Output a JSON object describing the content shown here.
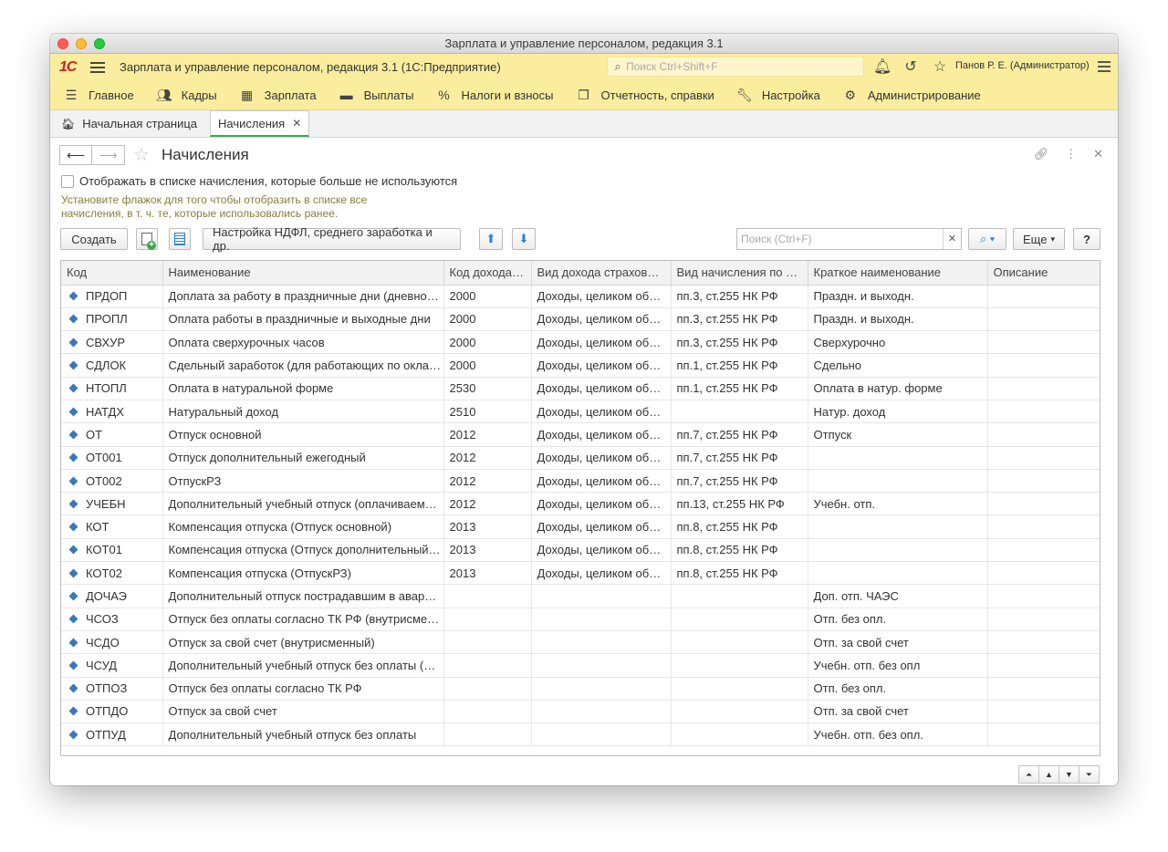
{
  "window": {
    "title": "Зарплата и управление персоналом, редакция 3.1"
  },
  "appbar": {
    "logo": "1С",
    "title": "Зарплата и управление персоналом, редакция 3.1  (1С:Предприятие)",
    "search_placeholder": "Поиск Ctrl+Shift+F",
    "user": "Панов Р. Е. (Администратор)"
  },
  "sections": [
    {
      "label": "Главное"
    },
    {
      "label": "Кадры"
    },
    {
      "label": "Зарплата"
    },
    {
      "label": "Выплаты"
    },
    {
      "label": "Налоги и взносы"
    },
    {
      "label": "Отчетность, справки"
    },
    {
      "label": "Настройка"
    },
    {
      "label": "Администрирование"
    }
  ],
  "tabs": {
    "home": "Начальная страница",
    "current": "Начисления"
  },
  "form": {
    "title": "Начисления",
    "checkbox_label": "Отображать в списке начисления, которые больше не используются",
    "hint_line1": "Установите флажок для того чтобы отобразить в списке все",
    "hint_line2": "начисления, в т. ч. те, которые использовались ранее."
  },
  "toolbar": {
    "create": "Создать",
    "settings": "Настройка НДФЛ, среднего заработка и др.",
    "filter_placeholder": "Поиск (Ctrl+F)",
    "more": "Еще",
    "help": "?"
  },
  "columns": [
    "Код",
    "Наименование",
    "Код дохода…",
    "Вид дохода страхов…",
    "Вид начисления по …",
    "Краткое наименование",
    "Описание"
  ],
  "rows": [
    [
      "ПРДОП",
      "Доплата за работу в праздничные дни (дневно…",
      "2000",
      "Доходы, целиком об…",
      "пп.3, ст.255 НК РФ",
      "Праздн. и выходн.",
      ""
    ],
    [
      "ПРОПЛ",
      "Оплата работы в праздничные и выходные дни",
      "2000",
      "Доходы, целиком об…",
      "пп.3, ст.255 НК РФ",
      "Праздн. и выходн.",
      ""
    ],
    [
      "СВХУР",
      "Оплата сверхурочных часов",
      "2000",
      "Доходы, целиком об…",
      "пп.3, ст.255 НК РФ",
      "Сверхурочно",
      ""
    ],
    [
      "СДЛОК",
      "Сдельный заработок (для работающих по окла…",
      "2000",
      "Доходы, целиком об…",
      "пп.1, ст.255 НК РФ",
      "Сдельно",
      ""
    ],
    [
      "НТОПЛ",
      "Оплата в натуральной форме",
      "2530",
      "Доходы, целиком об…",
      "пп.1, ст.255 НК РФ",
      "Оплата в натур. форме",
      ""
    ],
    [
      "НАТДХ",
      "Натуральный доход",
      "2510",
      "Доходы, целиком об…",
      "",
      "Натур. доход",
      ""
    ],
    [
      "ОТ",
      "Отпуск основной",
      "2012",
      "Доходы, целиком об…",
      "пп.7, ст.255 НК РФ",
      "Отпуск",
      ""
    ],
    [
      "ОТ001",
      "Отпуск дополнительный ежегодный",
      "2012",
      "Доходы, целиком об…",
      "пп.7, ст.255 НК РФ",
      "",
      ""
    ],
    [
      "ОТ002",
      "ОтпускРЗ",
      "2012",
      "Доходы, целиком об…",
      "пп.7, ст.255 НК РФ",
      "",
      ""
    ],
    [
      "УЧЕБН",
      "Дополнительный учебный отпуск (оплачиваем…",
      "2012",
      "Доходы, целиком об…",
      "пп.13, ст.255 НК РФ",
      "Учебн. отп.",
      ""
    ],
    [
      "КОТ",
      "Компенсация отпуска (Отпуск основной)",
      "2013",
      "Доходы, целиком об…",
      "пп.8, ст.255 НК РФ",
      "",
      ""
    ],
    [
      "КОТ01",
      "Компенсация отпуска (Отпуск дополнительный…",
      "2013",
      "Доходы, целиком об…",
      "пп.8, ст.255 НК РФ",
      "",
      ""
    ],
    [
      "КОТ02",
      "Компенсация отпуска (ОтпускРЗ)",
      "2013",
      "Доходы, целиком об…",
      "пп.8, ст.255 НК РФ",
      "",
      ""
    ],
    [
      "ДОЧАЭ",
      "Дополнительный отпуск пострадавшим в авар…",
      "",
      "",
      "",
      "Доп. отп. ЧАЭС",
      ""
    ],
    [
      "ЧСОЗ",
      "Отпуск без оплаты согласно ТК РФ (внутрисме…",
      "",
      "",
      "",
      "Отп. без опл.",
      ""
    ],
    [
      "ЧСДО",
      "Отпуск за свой счет (внутрисменный)",
      "",
      "",
      "",
      "Отп. за свой счет",
      ""
    ],
    [
      "ЧСУД",
      "Дополнительный учебный отпуск без оплаты (…",
      "",
      "",
      "",
      "Учебн. отп. без опл",
      ""
    ],
    [
      "ОТПОЗ",
      "Отпуск без оплаты согласно ТК РФ",
      "",
      "",
      "",
      "Отп. без опл.",
      ""
    ],
    [
      "ОТПДО",
      "Отпуск за свой счет",
      "",
      "",
      "",
      "Отп. за свой счет",
      ""
    ],
    [
      "ОТПУД",
      "Дополнительный учебный отпуск без оплаты",
      "",
      "",
      "",
      "Учебн. отп. без опл.",
      ""
    ]
  ],
  "colors": {
    "accent_yellow": "#fbed9e",
    "active_tab_line": "#3ca84b",
    "hint_text": "#8a7c3a",
    "row_marker": "#3a78b8"
  }
}
